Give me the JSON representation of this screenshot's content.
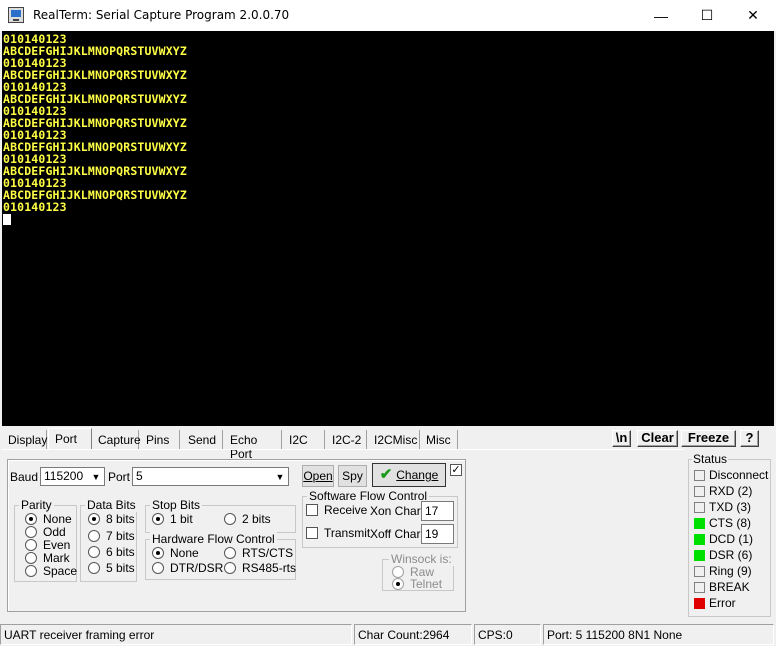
{
  "window": {
    "title": "RealTerm: Serial Capture Program 2.0.0.70",
    "minimize_glyph": "—",
    "maximize_glyph": "☐",
    "close_glyph": "✕"
  },
  "terminal": {
    "lines": [
      "010140123",
      "ABCDEFGHIJKLMNOPQRSTUVWXYZ",
      "010140123",
      "ABCDEFGHIJKLMNOPQRSTUVWXYZ",
      "010140123",
      "ABCDEFGHIJKLMNOPQRSTUVWXYZ",
      "010140123",
      "ABCDEFGHIJKLMNOPQRSTUVWXYZ",
      "010140123",
      "ABCDEFGHIJKLMNOPQRSTUVWXYZ",
      "010140123",
      "ABCDEFGHIJKLMNOPQRSTUVWXYZ",
      "010140123",
      "ABCDEFGHIJKLMNOPQRSTUVWXYZ",
      "010140123"
    ],
    "text_color": "#ffff45",
    "background": "#000000"
  },
  "tabs": [
    "Display",
    "Port",
    "Capture",
    "Pins",
    "Send",
    "Echo Port",
    "I2C",
    "I2C-2",
    "I2CMisc",
    "Misc"
  ],
  "active_tab": "Port",
  "toolbar": {
    "newline": "\\n",
    "clear": "Clear",
    "freeze": "Freeze",
    "help": "?"
  },
  "port": {
    "baud_label": "Baud",
    "baud_value": "115200",
    "port_label": "Port",
    "port_value": "5",
    "open_label": "Open",
    "spy_label": "Spy",
    "change_label": "Change",
    "change_checked": true,
    "parity": {
      "title": "Parity",
      "options": [
        "None",
        "Odd",
        "Even",
        "Mark",
        "Space"
      ],
      "selected": "None"
    },
    "data_bits": {
      "title": "Data Bits",
      "options": [
        "8 bits",
        "7 bits",
        "6 bits",
        "5 bits"
      ],
      "selected": "8 bits"
    },
    "stop_bits": {
      "title": "Stop Bits",
      "options": [
        "1 bit",
        "2 bits"
      ],
      "selected": "1 bit"
    },
    "hw_flow": {
      "title": "Hardware Flow Control",
      "options": [
        "None",
        "RTS/CTS",
        "DTR/DSR",
        "RS485-rts"
      ],
      "selected": "None"
    },
    "sw_flow": {
      "title": "Software Flow Control",
      "receive_label": "Receive",
      "transmit_label": "Transmit",
      "xon_label": "Xon Char:",
      "xon_value": "17",
      "xoff_label": "Xoff Char:",
      "xoff_value": "19"
    },
    "winsock": {
      "title": "Winsock is:",
      "options": [
        "Raw",
        "Telnet"
      ],
      "selected": "Telnet"
    }
  },
  "status": {
    "title": "Status",
    "indicators": [
      {
        "label": "Disconnect",
        "color": "#f0f0f0"
      },
      {
        "label": "RXD (2)",
        "color": "#f0f0f0"
      },
      {
        "label": "TXD (3)",
        "color": "#f0f0f0"
      },
      {
        "label": "CTS (8)",
        "color": "#00e000"
      },
      {
        "label": "DCD (1)",
        "color": "#00e000"
      },
      {
        "label": "DSR (6)",
        "color": "#00e000"
      },
      {
        "label": "Ring (9)",
        "color": "#f0f0f0"
      },
      {
        "label": "BREAK",
        "color": "#f0f0f0"
      },
      {
        "label": "Error",
        "color": "#e00000"
      }
    ]
  },
  "statusbar": {
    "message": "UART receiver framing error",
    "char_count": "Char Count:2964",
    "cps": "CPS:0",
    "port_info": "Port: 5 115200 8N1 None"
  }
}
